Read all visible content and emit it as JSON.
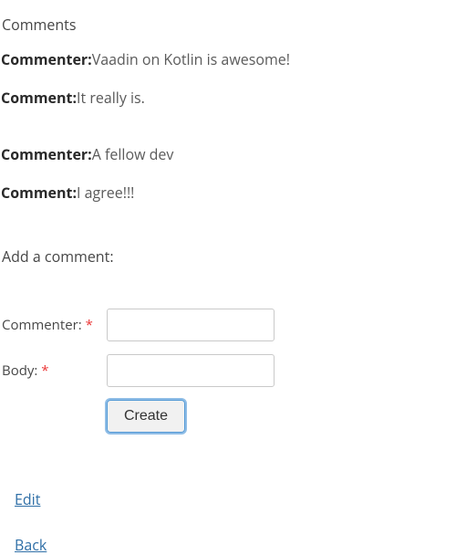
{
  "headings": {
    "comments": "Comments",
    "add_comment": "Add a comment:"
  },
  "labels": {
    "commenter": "Commenter:",
    "comment": "Comment:"
  },
  "comments": [
    {
      "commenter": "Vaadin on Kotlin is awesome!",
      "body": "It really is."
    },
    {
      "commenter": "A fellow dev",
      "body": "I agree!!!"
    }
  ],
  "form": {
    "commenter_label": "Commenter: ",
    "body_label": "Body: ",
    "required_mark": "*",
    "commenter_value": "",
    "body_value": "",
    "create_label": "Create"
  },
  "links": {
    "edit": "Edit",
    "back": "Back"
  }
}
